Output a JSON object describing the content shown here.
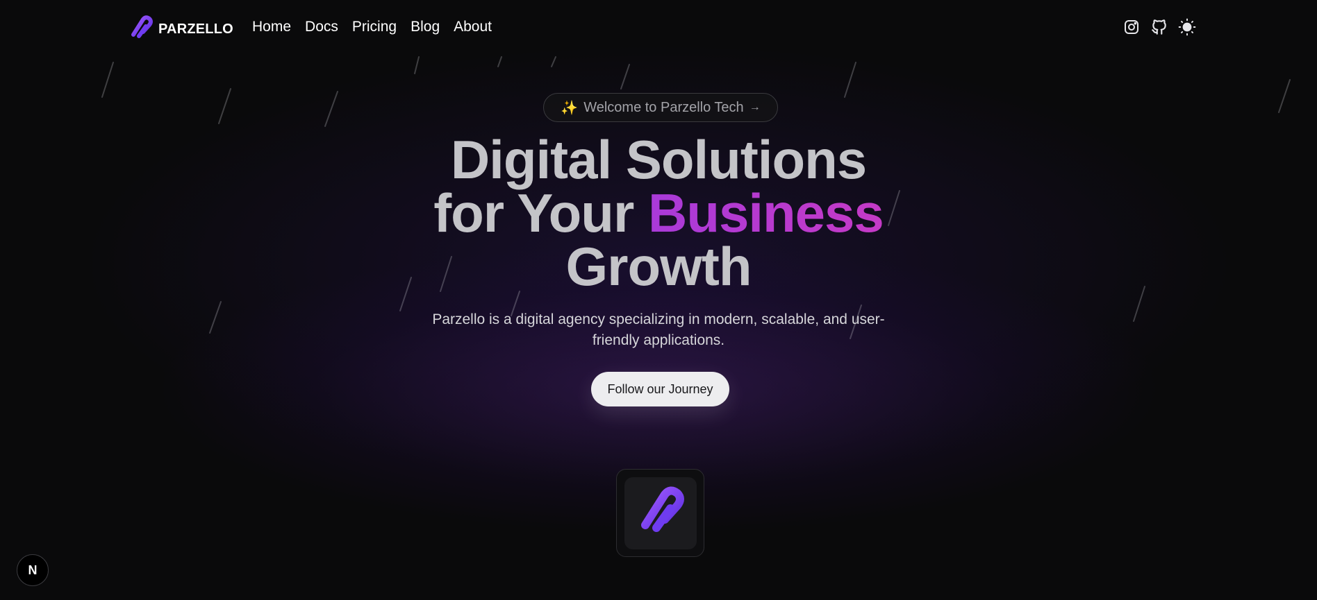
{
  "brand": {
    "name": "PARZELLO",
    "logo_icon": "parzello-logo-icon",
    "accent": "#8b3cf0"
  },
  "nav": {
    "items": [
      {
        "label": "Home"
      },
      {
        "label": "Docs"
      },
      {
        "label": "Pricing"
      },
      {
        "label": "Blog"
      },
      {
        "label": "About"
      }
    ],
    "icons": [
      "instagram-icon",
      "github-icon",
      "sun-icon"
    ]
  },
  "hero": {
    "badge": {
      "icon": "sparkles-icon",
      "text": "Welcome to Parzello Tech",
      "arrow": "→"
    },
    "headline": {
      "line1": "Digital Solutions",
      "line2_start": "for Your ",
      "line2_accent": "Business",
      "line3": "Growth"
    },
    "subtitle": "Parzello is a digital agency specializing in modern, scalable, and user-friendly applications.",
    "cta_label": "Follow our Journey",
    "accent_color": "#b43ad2"
  },
  "dev_indicator": {
    "label": "N"
  }
}
